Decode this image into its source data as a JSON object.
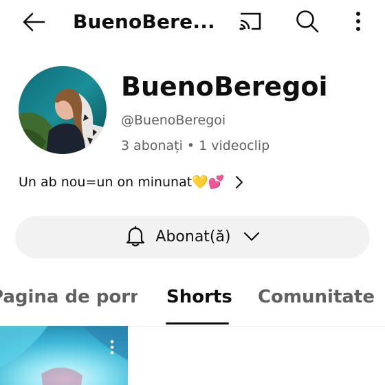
{
  "topbar": {
    "title": "BuenoBere...",
    "icons": [
      "back-arrow-icon",
      "cast-icon",
      "search-icon",
      "more-vertical-icon"
    ]
  },
  "channel": {
    "name": "BuenoBeregoi",
    "handle": "@BuenoBeregoi",
    "subscribers": "3 abonați",
    "separator": "•",
    "videos": "1 videoclip",
    "description": "Un ab nou=un on minunat💛💕"
  },
  "subscribe_button": {
    "label": "Abonat(ă)"
  },
  "tabs": [
    {
      "label": "Pagina de pornire"
    },
    {
      "label": "Shorts",
      "selected": true
    },
    {
      "label": "Comunitate"
    }
  ],
  "colors": {
    "text_primary": "#0f0f0f",
    "text_secondary": "#606060",
    "button_bg": "#f2f2f2",
    "thumb_accent": "#5fd3e8"
  }
}
